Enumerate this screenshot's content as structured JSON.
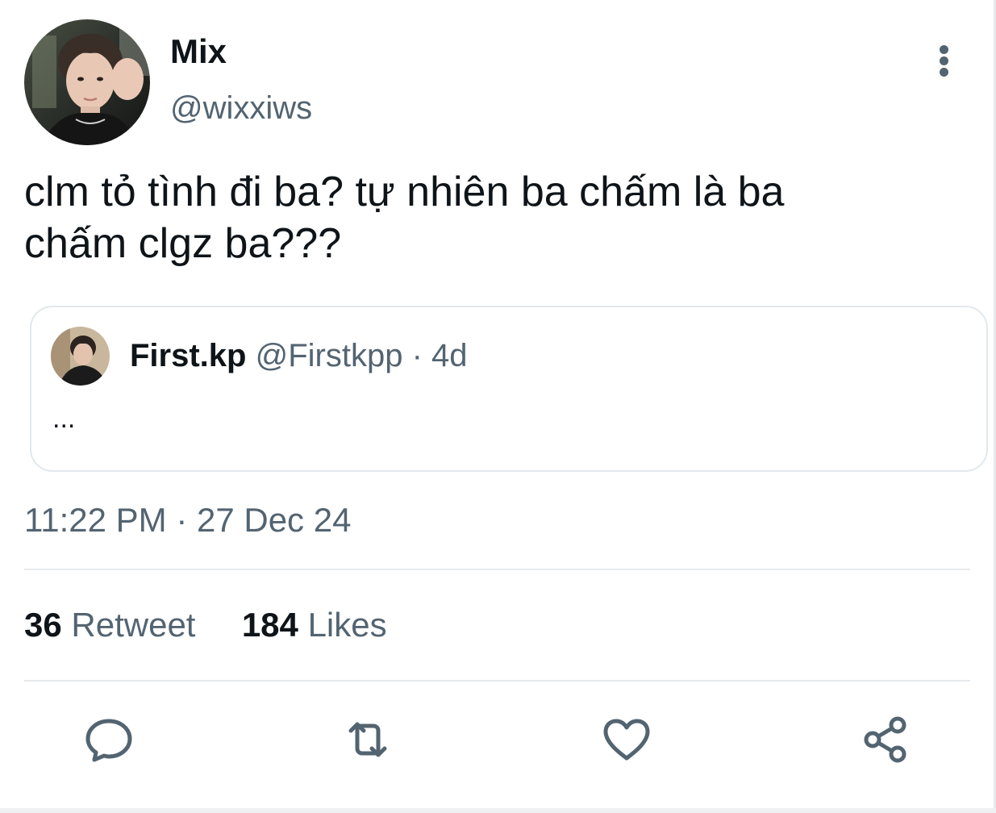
{
  "tweet": {
    "author": {
      "display_name": "Mix",
      "handle": "@wixxiws"
    },
    "text": "clm tỏ tình đi ba? tự nhiên ba chấm là ba\nchấm clgz ba???",
    "quoted": {
      "display_name": "First.kp",
      "handle": "@Firstkpp",
      "separator": "·",
      "age": "4d",
      "body": "..."
    },
    "timestamp": "11:22 PM · 27 Dec 24",
    "stats": {
      "retweets_count": "36",
      "retweets_label": "Retweet",
      "likes_count": "184",
      "likes_label": "Likes"
    }
  },
  "icons": {
    "more": "vertical-ellipsis-icon",
    "reply": "speech-bubble-icon",
    "retweet": "retweet-arrows-icon",
    "like": "heart-outline-icon",
    "share": "share-nodes-icon"
  },
  "colors": {
    "text_primary": "#0f1419",
    "text_secondary": "#536471",
    "border": "#e1e8ed",
    "background": "#ffffff"
  }
}
